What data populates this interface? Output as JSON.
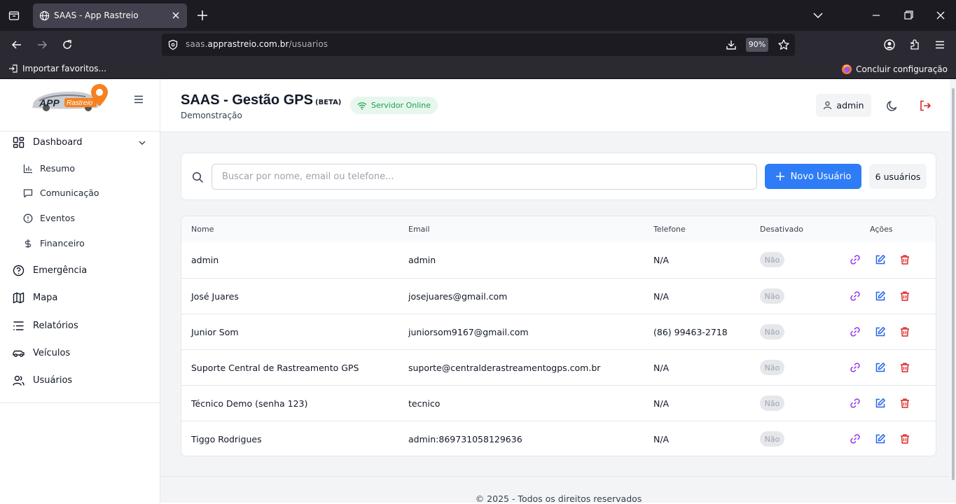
{
  "browser": {
    "tab_title": "SAAS - App Rastreio",
    "url_domain_prefix": "saas.",
    "url_domain": "apprastreio.com.br",
    "url_path": "/usuarios",
    "zoom": "90%",
    "bookmark_import": "Importar favoritos...",
    "finish_setup": "Concluir configuração"
  },
  "header": {
    "title": "SAAS - Gestão GPS",
    "beta": "(BETA)",
    "subtitle": "Demonstração",
    "server_status": "Servidor Online",
    "user": "admin"
  },
  "sidebar": {
    "logo_text": "APP Rastreio",
    "dashboard": "Dashboard",
    "sub": [
      "Resumo",
      "Comunicação",
      "Eventos",
      "Financeiro"
    ],
    "items": [
      "Emergência",
      "Mapa",
      "Relatórios",
      "Veículos",
      "Usuários"
    ]
  },
  "search": {
    "placeholder": "Buscar por nome, email ou telefone...",
    "new_button": "Novo Usuário",
    "count": "6 usuários"
  },
  "table": {
    "headers": [
      "Nome",
      "Email",
      "Telefone",
      "Desativado",
      "Ações"
    ],
    "rows": [
      {
        "name": "admin",
        "email": "admin",
        "phone": "N/A",
        "disabled": "Não"
      },
      {
        "name": "José Juares",
        "email": "josejuares@gmail.com",
        "phone": "N/A",
        "disabled": "Não"
      },
      {
        "name": "Junior Som",
        "email": "juniorsom9167@gmail.com",
        "phone": "(86) 99463-2718",
        "disabled": "Não"
      },
      {
        "name": "Suporte Central de Rastreamento GPS",
        "email": "suporte@centralderastreamentogps.com.br",
        "phone": "N/A",
        "disabled": "Não"
      },
      {
        "name": "Técnico Demo (senha 123)",
        "email": "tecnico",
        "phone": "N/A",
        "disabled": "Não"
      },
      {
        "name": "Tiggo Rodrigues",
        "email": "admin:869731058129636",
        "phone": "N/A",
        "disabled": "Não"
      }
    ]
  },
  "footer": "© 2025 - Todos os direitos reservados",
  "colors": {
    "primary": "#2e7cf6",
    "link_action": "#9333ea",
    "edit_action": "#2563eb",
    "delete_action": "#dc2626",
    "online": "#16a34a"
  }
}
